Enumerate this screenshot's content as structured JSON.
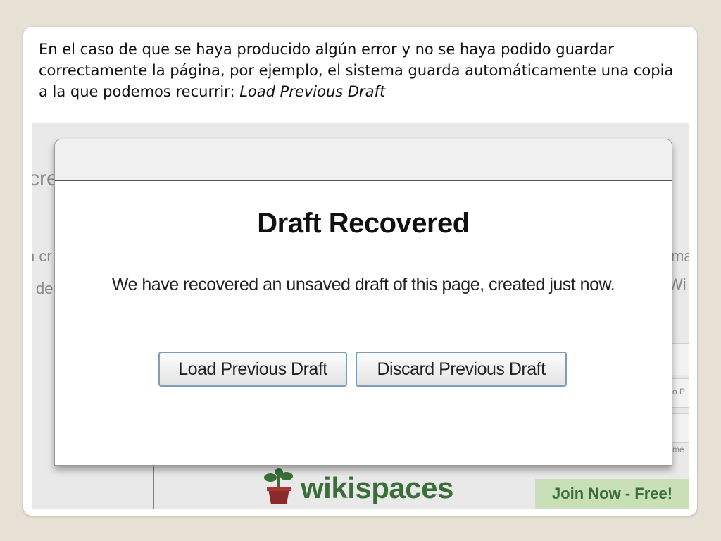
{
  "caption": {
    "text": "En el caso de que se haya producido algún error y no se haya podido guardar correctamente la página, por ejemplo, el sistema guarda automáticamente una copia a la que podemos recurrir: ",
    "emphasis": "Load Previous Draft"
  },
  "dialog": {
    "title": "Draft Recovered",
    "message": "We have recovered an unsaved draft of this page, created just now.",
    "load_button": "Load Previous Draft",
    "discard_button": "Discard Previous Draft"
  },
  "background": {
    "frag_left_top": "cre",
    "frag_left_mid": "n cr",
    "frag_left_low": "de",
    "frag_right_top": "ma",
    "frag_right_mid": "Wi",
    "frag_right_small1": "o P",
    "frag_right_small2": "me",
    "logo_text": "wikispaces",
    "join_text": "Join Now - Free!"
  },
  "colors": {
    "slide_bg": "#e6e0d5",
    "wiki_green": "#3b6f39",
    "button_border": "#7f9db9"
  },
  "icons": {
    "logo": "wikispaces-plant-icon"
  }
}
